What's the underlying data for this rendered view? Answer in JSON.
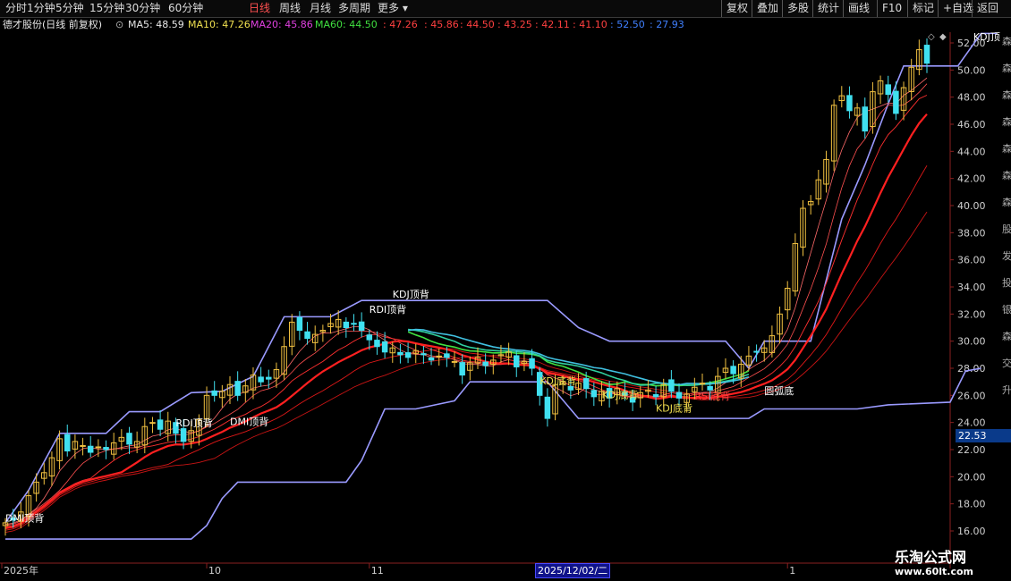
{
  "toolbar": {
    "periods": [
      "分时",
      "1分钟",
      "5分钟",
      "15分钟",
      "30分钟",
      "60分钟",
      "日线",
      "周线",
      "月线",
      "多周期",
      "更多"
    ],
    "active_period": "日线",
    "right_buttons": [
      "复权",
      "叠加",
      "多股",
      "统计",
      "画线",
      "F10",
      "标记",
      "+自选",
      "返回"
    ]
  },
  "legend": {
    "stock": "德才股份(日线 前复权)",
    "ma": [
      {
        "label": "MA5: 48.59",
        "color": "#e8e8e8"
      },
      {
        "label": "MA10: 47.26",
        "color": "#f0e050"
      },
      {
        "label": "MA20: 45.86",
        "color": "#e040e0"
      },
      {
        "label": "MA60: 44.50",
        "color": "#40e040"
      }
    ],
    "extra_values": [
      "47.26",
      "45.86",
      "44.50",
      "43.25",
      "42.11",
      "41.10",
      "52.50",
      "27.93"
    ],
    "extra_colors": [
      "#ff4040",
      "#ff4040",
      "#ff4040",
      "#ff4040",
      "#ff4040",
      "#ff4040",
      "#4080ff",
      "#4080ff"
    ]
  },
  "price_box": "22.53",
  "date_label": "2025/12/02/二",
  "watermark": {
    "line1": "乐淘公式网",
    "line2": "www.60lt.com"
  },
  "colors": {
    "up": "#ff3030",
    "down": "#40e0f0",
    "band": "#9a9aff",
    "yellow": "#f0e050"
  },
  "chart_data": {
    "type": "candlestick",
    "ylim": [
      16,
      53
    ],
    "y_ticks": [
      "16.00",
      "18.00",
      "20.00",
      "22.00",
      "24.00",
      "26.00",
      "28.00",
      "30.00",
      "32.00",
      "34.00",
      "36.00",
      "38.00",
      "40.00",
      "42.00",
      "44.00",
      "46.00",
      "48.00",
      "50.00",
      "52.00"
    ],
    "x_labels": [
      {
        "label": "2025年",
        "idx": 0
      },
      {
        "label": "10",
        "idx": 26
      },
      {
        "label": "11",
        "idx": 47
      },
      {
        "label": "12",
        "idx": 73
      },
      {
        "label": "1",
        "idx": 101
      }
    ],
    "closes": [
      16.6,
      16.8,
      17.4,
      18.6,
      19.6,
      20.3,
      21.4,
      22.8,
      21.9,
      22.6,
      22.3,
      21.8,
      22.2,
      22.0,
      22.5,
      22.9,
      22.4,
      22.6,
      23.7,
      24.0,
      23.5,
      24.1,
      23.2,
      22.6,
      23.4,
      24.2,
      26.0,
      26.0,
      26.3,
      26.8,
      26.0,
      26.7,
      27.5,
      27.0,
      27.2,
      27.9,
      29.6,
      31.4,
      30.8,
      30.2,
      30.5,
      30.8,
      31.3,
      31.6,
      31.0,
      31.3,
      30.8,
      30.1,
      29.6,
      29.2,
      29.5,
      29.0,
      28.8,
      29.3,
      29.0,
      28.6,
      28.9,
      28.8,
      28.5,
      27.5,
      28.4,
      28.8,
      28.2,
      28.6,
      29.0,
      29.2,
      28.1,
      28.5,
      28.0,
      26.0,
      24.3,
      26.8,
      27.0,
      26.4,
      26.9,
      26.5,
      25.9,
      26.3,
      25.8,
      26.5,
      26.0,
      25.5,
      26.2,
      26.4,
      25.9,
      26.8,
      26.3,
      25.8,
      26.1,
      26.6,
      26.9,
      26.4,
      27.4,
      28.0,
      27.6,
      28.3,
      28.9,
      29.2,
      29.5,
      30.4,
      32.0,
      33.9,
      37.2,
      39.8,
      40.3,
      41.9,
      43.4,
      47.4,
      48.1,
      47.0,
      47.2,
      45.5,
      48.4,
      49.2,
      48.2,
      46.8,
      48.7,
      50.2,
      51.5,
      50.5
    ],
    "band_upper_steps": [
      [
        0,
        16.6
      ],
      [
        3,
        19.0
      ],
      [
        7,
        23.2
      ],
      [
        13,
        23.2
      ],
      [
        16,
        24.8
      ],
      [
        20,
        24.8
      ],
      [
        24,
        26.2
      ],
      [
        28,
        26.3
      ],
      [
        32,
        27.4
      ],
      [
        36,
        31.8
      ],
      [
        42,
        31.8
      ],
      [
        46,
        33.0
      ],
      [
        50,
        33.0
      ],
      [
        58,
        33.0
      ],
      [
        70,
        33.0
      ],
      [
        74,
        31.0
      ],
      [
        78,
        30.0
      ],
      [
        86,
        30.0
      ],
      [
        93,
        30.0
      ],
      [
        96,
        28.0
      ],
      [
        98,
        30.0
      ],
      [
        104,
        30.0
      ],
      [
        108,
        39.0
      ],
      [
        111,
        43.0
      ],
      [
        114,
        47.5
      ],
      [
        116,
        50.3
      ],
      [
        123,
        50.3
      ],
      [
        126,
        52.7
      ],
      [
        128,
        52.7
      ]
    ],
    "band_lower_steps": [
      [
        0,
        15.4
      ],
      [
        24,
        15.4
      ],
      [
        26,
        16.4
      ],
      [
        28,
        18.4
      ],
      [
        30,
        19.6
      ],
      [
        44,
        19.6
      ],
      [
        46,
        21.2
      ],
      [
        49,
        25.0
      ],
      [
        53,
        25.0
      ],
      [
        58,
        25.6
      ],
      [
        60,
        27.0
      ],
      [
        62,
        27.0
      ],
      [
        70,
        27.0
      ],
      [
        74,
        24.3
      ],
      [
        96,
        24.3
      ],
      [
        98,
        25.0
      ],
      [
        110,
        25.0
      ],
      [
        114,
        25.3
      ],
      [
        122,
        25.5
      ],
      [
        124,
        27.8
      ],
      [
        126,
        28.0
      ]
    ],
    "annotations": [
      {
        "text": "DMI顶背",
        "idx": 0,
        "price": 16.7,
        "color": "#ffffff"
      },
      {
        "text": "RDI顶背",
        "idx": 22,
        "price": 23.7,
        "color": "#ffffff"
      },
      {
        "text": "DMI顶背",
        "idx": 29,
        "price": 23.8,
        "color": "#ffffff"
      },
      {
        "text": "RDI顶背",
        "idx": 47,
        "price": 32.1,
        "color": "#ffffff"
      },
      {
        "text": "KDJ顶背",
        "idx": 50,
        "price": 33.2,
        "color": "#ffffff"
      },
      {
        "text": "KDJ底背",
        "idx": 69,
        "price": 26.8,
        "color": "#f0e050"
      },
      {
        "text": "KDJ底背",
        "idx": 77,
        "price": 25.8,
        "color": "#f0e050"
      },
      {
        "text": "KDJ底背",
        "idx": 84,
        "price": 24.8,
        "color": "#f0e050"
      },
      {
        "text": "RSI底背",
        "idx": 89,
        "price": 25.7,
        "color": "#ff4040"
      },
      {
        "text": "圆弧底",
        "idx": 98,
        "price": 26.1,
        "color": "#ffffff"
      },
      {
        "text": "KDJ顶",
        "idx": 125,
        "price": 52.2,
        "color": "#ffffff"
      }
    ],
    "side_glyphs": [
      "森",
      "森",
      "森",
      "森",
      "森",
      "森",
      "森",
      "股",
      "发",
      "投",
      "银",
      "森",
      "交",
      "升"
    ]
  }
}
